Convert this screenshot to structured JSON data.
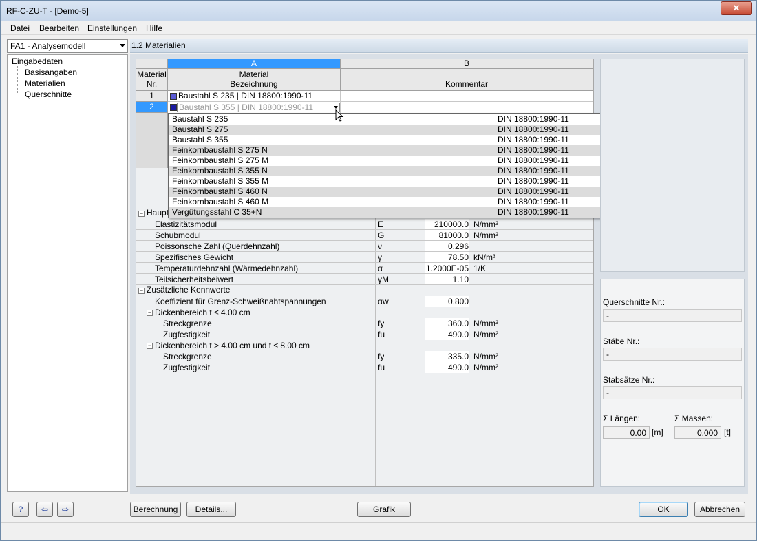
{
  "window": {
    "title": "RF-C-ZU-T - [Demo-5]",
    "close_label": "✕"
  },
  "menu": {
    "datei": "Datei",
    "bearbeiten": "Bearbeiten",
    "einstellungen": "Einstellungen",
    "hilfe": "Hilfe"
  },
  "model_combo": {
    "value": "FA1 - Analysemodell"
  },
  "tree": {
    "root": "Eingabedaten",
    "items": [
      "Basisangaben",
      "Materialien",
      "Querschnitte"
    ]
  },
  "section_title": "1.2 Materialien",
  "table": {
    "col_a": "A",
    "col_b": "B",
    "h_nr_1": "Material",
    "h_nr_2": "Nr.",
    "h_mat_1": "Material",
    "h_mat_2": "Bezeichnung",
    "h_komm": "Kommentar",
    "rows": [
      {
        "nr": "1",
        "name": "Baustahl S 235 | DIN 18800:1990-11"
      },
      {
        "nr": "2",
        "name": "Baustahl S 355 | DIN 18800:1990-11"
      }
    ]
  },
  "dropdown": {
    "items": [
      {
        "name": "Baustahl S 235",
        "norm": "DIN 18800:1990-11"
      },
      {
        "name": "Baustahl S 275",
        "norm": "DIN 18800:1990-11"
      },
      {
        "name": "Baustahl S 355",
        "norm": "DIN 18800:1990-11"
      },
      {
        "name": "Feinkornbaustahl S 275 N",
        "norm": "DIN 18800:1990-11"
      },
      {
        "name": "Feinkornbaustahl S 275 M",
        "norm": "DIN 18800:1990-11"
      },
      {
        "name": "Feinkornbaustahl S 355 N",
        "norm": "DIN 18800:1990-11"
      },
      {
        "name": "Feinkornbaustahl S 355 M",
        "norm": "DIN 18800:1990-11"
      },
      {
        "name": "Feinkornbaustahl S 460 N",
        "norm": "DIN 18800:1990-11"
      },
      {
        "name": "Feinkornbaustahl S 460 M",
        "norm": "DIN 18800:1990-11"
      },
      {
        "name": "Vergütungsstahl C 35+N",
        "norm": "DIN 18800:1990-11"
      }
    ]
  },
  "props": {
    "group_main": "Haupt",
    "rows": [
      {
        "name": "Elastizitätsmodul",
        "sym": "E",
        "val": "210000.0",
        "unit": "N/mm²"
      },
      {
        "name": "Schubmodul",
        "sym": "G",
        "val": "81000.0",
        "unit": "N/mm²"
      },
      {
        "name": "Poissonsche Zahl (Querdehnzahl)",
        "sym": "ν",
        "val": "0.296",
        "unit": ""
      },
      {
        "name": "Spezifisches Gewicht",
        "sym": "γ",
        "val": "78.50",
        "unit": "kN/m³"
      },
      {
        "name": "Temperaturdehnzahl (Wärmedehnzahl)",
        "sym": "α",
        "val": "1.2000E-05",
        "unit": "1/K"
      },
      {
        "name": "Teilsicherheitsbeiwert",
        "sym": "γM",
        "val": "1.10",
        "unit": ""
      }
    ],
    "group_extra": "Zusätzliche Kennwerte",
    "koeff": {
      "name": "Koeffizient für Grenz-Schweißnahtspannungen",
      "sym": "αw",
      "val": "0.800"
    },
    "dicke1": "Dickenbereich t ≤ 4.00 cm",
    "dicke1_rows": [
      {
        "name": "Streckgrenze",
        "sym": "fy",
        "val": "360.0",
        "unit": "N/mm²"
      },
      {
        "name": "Zugfestigkeit",
        "sym": "fu",
        "val": "490.0",
        "unit": "N/mm²"
      }
    ],
    "dicke2": "Dickenbereich t > 4.00 cm und t ≤ 8.00 cm",
    "dicke2_rows": [
      {
        "name": "Streckgrenze",
        "sym": "fy",
        "val": "335.0",
        "unit": "N/mm²"
      },
      {
        "name": "Zugfestigkeit",
        "sym": "fu",
        "val": "490.0",
        "unit": "N/mm²"
      }
    ]
  },
  "right": {
    "querschnitte_label": "Querschnitte Nr.:",
    "querschnitte_val": "-",
    "staebe_label": "Stäbe Nr.:",
    "staebe_val": "-",
    "stabsaetze_label": "Stabsätze Nr.:",
    "stabsaetze_val": "-",
    "laengen_label": "Σ Längen:",
    "laengen_val": "0.00",
    "laengen_unit": "[m]",
    "massen_label": "Σ Massen:",
    "massen_val": "0.000",
    "massen_unit": "[t]"
  },
  "buttons": {
    "berechnung": "Berechnung",
    "details": "Details...",
    "grafik": "Grafik",
    "ok": "OK",
    "abbrechen": "Abbrechen"
  },
  "colors": {
    "swatch1": "#5b5bd6",
    "swatch2": "#1a1aa0",
    "selected_row": "#3399ff"
  }
}
